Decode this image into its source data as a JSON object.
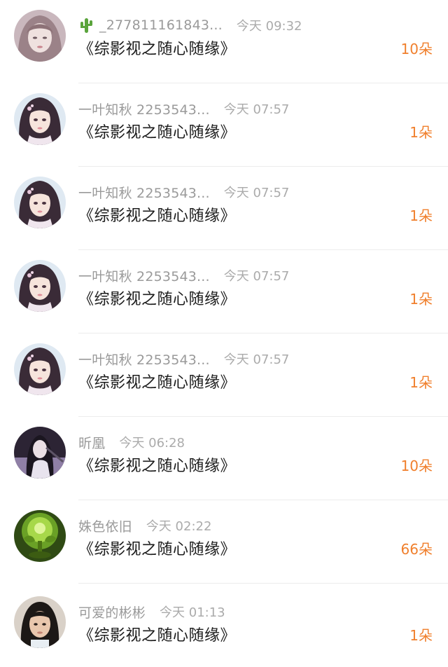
{
  "gifts": [
    {
      "name": "_277811161843...",
      "has_cactus": true,
      "time": "今天 09:32",
      "book": "《综影视之随心随缘》",
      "count": "10朵",
      "avatar": "portrait-pale-woman"
    },
    {
      "name": "一叶知秋 2253543...",
      "has_cactus": false,
      "time": "今天 07:57",
      "book": "《综影视之随心随缘》",
      "count": "1朵",
      "avatar": "ancient-style-girl"
    },
    {
      "name": "一叶知秋 2253543...",
      "has_cactus": false,
      "time": "今天 07:57",
      "book": "《综影视之随心随缘》",
      "count": "1朵",
      "avatar": "ancient-style-girl"
    },
    {
      "name": "一叶知秋 2253543...",
      "has_cactus": false,
      "time": "今天 07:57",
      "book": "《综影视之随心随缘》",
      "count": "1朵",
      "avatar": "ancient-style-girl"
    },
    {
      "name": "一叶知秋 2253543...",
      "has_cactus": false,
      "time": "今天 07:57",
      "book": "《综影视之随心随缘》",
      "count": "1朵",
      "avatar": "ancient-style-girl"
    },
    {
      "name": "昕凰",
      "has_cactus": false,
      "time": "今天 06:28",
      "book": "《综影视之随心随缘》",
      "count": "10朵",
      "avatar": "swordswoman-purple"
    },
    {
      "name": "姝色依旧",
      "has_cactus": false,
      "time": "今天 02:22",
      "book": "《综影视之随心随缘》",
      "count": "66朵",
      "avatar": "green-plant"
    },
    {
      "name": "可爱的彬彬",
      "has_cactus": false,
      "time": "今天 01:13",
      "book": "《综影视之随心随缘》",
      "count": "1朵",
      "avatar": "selfie-girl"
    }
  ],
  "colors": {
    "count": "#f07f2c",
    "name": "#9a9a9a",
    "time": "#ababab",
    "book": "#1c1c1c"
  }
}
